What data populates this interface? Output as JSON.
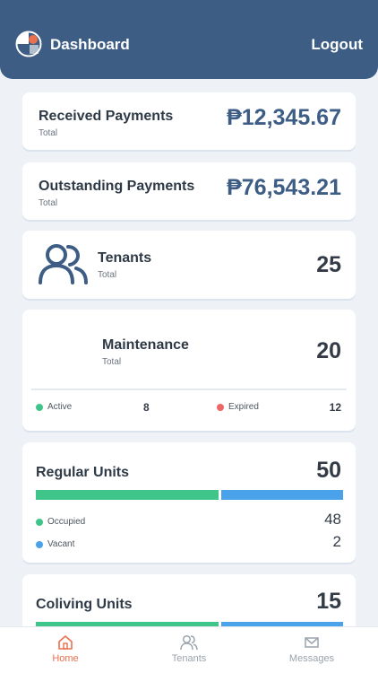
{
  "header": {
    "title": "Dashboard",
    "logout_label": "Logout"
  },
  "received": {
    "title": "Received Payments",
    "subtitle": "Total",
    "amount": "₱12,345.67"
  },
  "outstanding": {
    "title": "Outstanding Payments",
    "subtitle": "Total",
    "amount": "₱76,543.21"
  },
  "tenants": {
    "title": "Tenants",
    "subtitle": "Total",
    "count": "25"
  },
  "maintenance": {
    "title": "Maintenance",
    "subtitle": "Total",
    "count": "20",
    "active_label": "Active",
    "active_count": "8",
    "expired_label": "Expired",
    "expired_count": "12"
  },
  "regular_units": {
    "title": "Regular Units",
    "count": "50",
    "occupied_label": "Occupied",
    "occupied_count": "48",
    "vacant_label": "Vacant",
    "vacant_count": "2",
    "occupied_fraction": 0.6
  },
  "coliving_units": {
    "title": "Coliving Units",
    "count": "15",
    "occupied_fraction": 0.6
  },
  "tabs": [
    {
      "label": "Home",
      "icon": "home-icon",
      "active": true
    },
    {
      "label": "Tenants",
      "icon": "users-icon",
      "active": false
    },
    {
      "label": "Messages",
      "icon": "mail-icon",
      "active": false
    }
  ],
  "colors": {
    "primary": "#3d5d85",
    "accent": "#e9714f",
    "occupied": "#3fc58a",
    "vacant": "#4aa3ea",
    "active": "#3fc58a",
    "expired": "#ee6666",
    "inactive_tab": "#9aa3ad"
  }
}
